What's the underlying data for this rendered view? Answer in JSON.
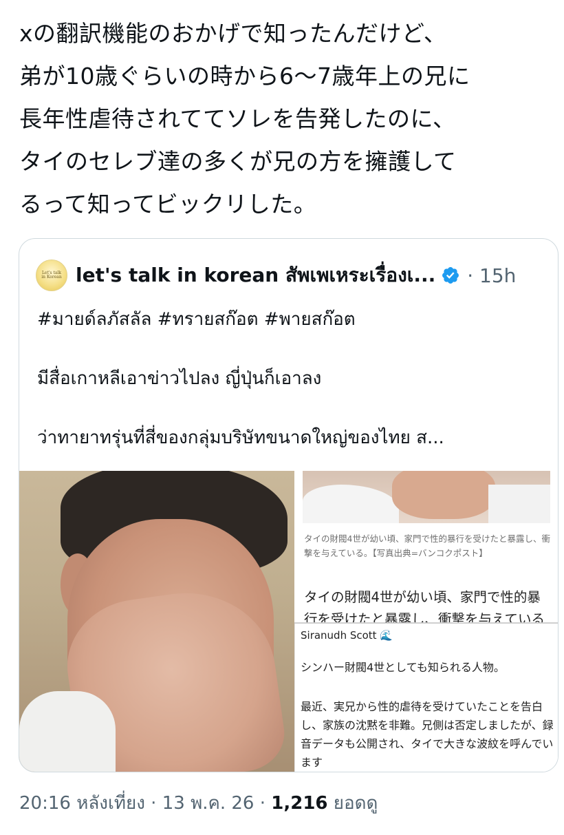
{
  "tweet": {
    "text": "xの翻訳機能のおかげで知ったんだけど、\n弟が10歳ぐらいの時から6〜7歳年上の兄に\n長年性虐待されててソレを告発したのに、\nタイのセレブ達の多くが兄の方を擁護して\nるって知ってビックリした。"
  },
  "quote": {
    "author_name": "let's talk in korean สัพเพเหระเรื่องเ...",
    "time": "15h",
    "time_separator": "·",
    "avatar_text": "Let's talk in Korean",
    "lines": [
      "#มายด์ลภัสลัล #ทรายสก๊อต #พายสก๊อต",
      "มีสื่อเกาหลีเอาข่าวไปลง ญี่ปุ่นก็เอาลง",
      "ว่าทายาทรุ่นที่สี่ของกลุ่มบริษัทขนาดใหญ่ของไทย ส..."
    ]
  },
  "image": {
    "caption": "タイの財閥4世が幼い頃、家門で性的暴行を受けたと暴露し、衝撃を与えている。【写真出典=バンコクポスト】",
    "article_headline": "タイの財閥4世が幼い頃、家門で性的暴行を受けたと暴露し、衝撃を与えている",
    "post_author": "Siranudh Scott 🌊",
    "post_line1": "シンハー財閥4世としても知られる人物。",
    "post_paragraph": "最近、実兄から性的虐待を受けていたことを告白し、家族の沈黙を非難。兄側は否定しましたが、録音データも公開され、タイで大きな波紋を呼んでいます"
  },
  "footer": {
    "time": "20:16 หลังเที่ยง",
    "sep1": " · ",
    "date": "13 พ.ค. 26",
    "sep2": " · ",
    "views_count": "1,216",
    "views_label": " ยอดดู"
  },
  "colors": {
    "text": "#0f1419",
    "muted": "#536471",
    "border": "#cfd9de",
    "verified": "#1d9bf0"
  },
  "icons": {
    "verified": "verified-badge-icon"
  }
}
